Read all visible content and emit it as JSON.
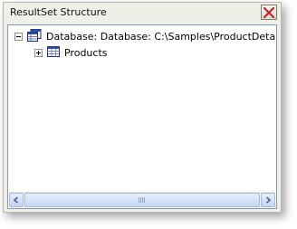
{
  "window": {
    "title": "ResultSet Structure"
  },
  "tree": {
    "root": {
      "label": "Database: Database: C:\\Samples\\ProductDetails.mdb",
      "expanded": true,
      "icon": "database-icon",
      "children": [
        {
          "label": "Products",
          "expanded": false,
          "icon": "table-icon"
        }
      ]
    }
  },
  "icons": {
    "close": "close-icon",
    "scroll_left": "arrow-left-icon",
    "scroll_right": "arrow-right-icon"
  },
  "colors": {
    "window_bg": "#f0efe7",
    "panel_border": "#7f9db9",
    "close_x": "#c0282d"
  }
}
